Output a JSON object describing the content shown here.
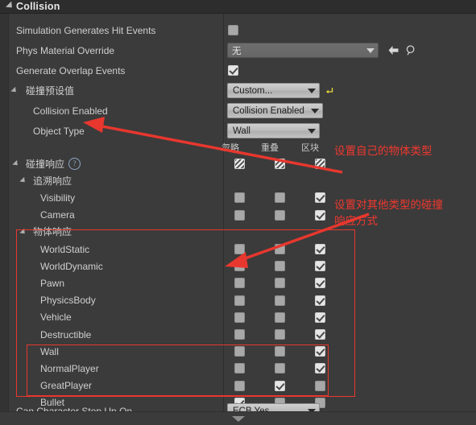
{
  "panel": {
    "category_title": "Collision",
    "expander_icon": "triangle-down-icon"
  },
  "rows": {
    "simulation_generates_hit_events": {
      "label": "Simulation Generates Hit Events",
      "checked": false
    },
    "phys_material_override": {
      "label": "Phys Material Override",
      "value": "无",
      "back_icon": "arrow-left-icon",
      "browse_icon": "magnifier-icon"
    },
    "generate_overlap_events": {
      "label": "Generate Overlap Events",
      "checked": true
    },
    "collision_presets": {
      "label": "碰撞预设值",
      "value": "Custom...",
      "reset_icon": "reset-arrow-icon"
    },
    "collision_enabled": {
      "label": "Collision Enabled",
      "value": "Collision Enabled"
    },
    "object_type": {
      "label": "Object Type",
      "value": "Wall"
    },
    "collision_responses": {
      "label": "碰撞响应",
      "help_icon": "question-mark-icon"
    },
    "trace_responses_group": {
      "label": "追溯响应"
    },
    "object_responses_group": {
      "label": "物体响应"
    },
    "can_character_step_up_on": {
      "label": "Can Character Step Up On",
      "value": "ECB Yes"
    }
  },
  "columns": {
    "headers": [
      "忽略",
      "重叠",
      "区块"
    ]
  },
  "response_rows": [
    {
      "name": "碰撞响应",
      "type": "master",
      "indent": 2,
      "cn": true,
      "states": [
        "mixed",
        "mixed",
        "mixed"
      ]
    },
    {
      "name": "追溯响应",
      "type": "group",
      "indent": 3,
      "cn": true,
      "states": [
        null,
        null,
        null
      ]
    },
    {
      "name": "Visibility",
      "type": "item",
      "indent": 4,
      "cn": false,
      "states": [
        "off",
        "off",
        "on"
      ]
    },
    {
      "name": "Camera",
      "type": "item",
      "indent": 4,
      "cn": false,
      "states": [
        "off",
        "off",
        "on"
      ]
    },
    {
      "name": "物体响应",
      "type": "group",
      "indent": 3,
      "cn": true,
      "states": [
        null,
        null,
        null
      ]
    },
    {
      "name": "WorldStatic",
      "type": "item",
      "indent": 4,
      "cn": false,
      "states": [
        "off",
        "off",
        "on"
      ]
    },
    {
      "name": "WorldDynamic",
      "type": "item",
      "indent": 4,
      "cn": false,
      "states": [
        "off",
        "off",
        "on"
      ]
    },
    {
      "name": "Pawn",
      "type": "item",
      "indent": 4,
      "cn": false,
      "states": [
        "off",
        "off",
        "on"
      ]
    },
    {
      "name": "PhysicsBody",
      "type": "item",
      "indent": 4,
      "cn": false,
      "states": [
        "off",
        "off",
        "on"
      ]
    },
    {
      "name": "Vehicle",
      "type": "item",
      "indent": 4,
      "cn": false,
      "states": [
        "off",
        "off",
        "on"
      ]
    },
    {
      "name": "Destructible",
      "type": "item",
      "indent": 4,
      "cn": false,
      "states": [
        "off",
        "off",
        "on"
      ]
    },
    {
      "name": "Wall",
      "type": "item",
      "indent": 4,
      "cn": false,
      "states": [
        "off",
        "off",
        "on"
      ]
    },
    {
      "name": "NormalPlayer",
      "type": "item",
      "indent": 4,
      "cn": false,
      "states": [
        "off",
        "off",
        "on"
      ]
    },
    {
      "name": "GreatPlayer",
      "type": "item",
      "indent": 4,
      "cn": false,
      "states": [
        "off",
        "on",
        "off"
      ]
    },
    {
      "name": "Bullet",
      "type": "item",
      "indent": 4,
      "cn": false,
      "states": [
        "on",
        "off",
        "off"
      ]
    }
  ],
  "annotations": {
    "accent_color": "#e8372e",
    "note_object_type": "设置自己的物体类型",
    "note_responses_line1": "设置对其他类型的碰撞",
    "note_responses_line2": "响应方式"
  }
}
